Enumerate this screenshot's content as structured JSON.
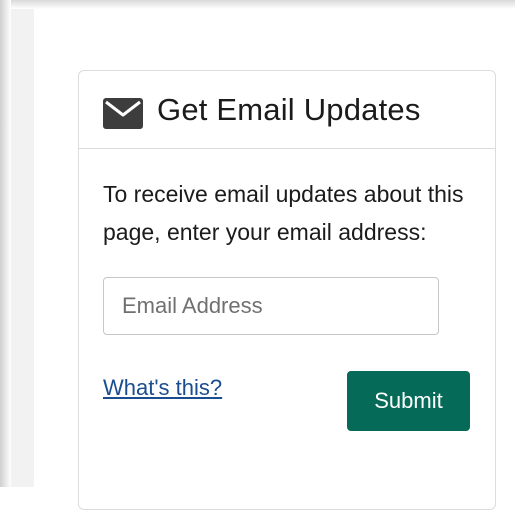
{
  "card": {
    "title": "Get Email Updates",
    "icon": "envelope-icon",
    "intro": "To receive email updates about this page, enter your email address:",
    "email_input": {
      "placeholder": "Email Address",
      "value": ""
    },
    "whats_this_link": "What's this?",
    "submit_label": "Submit"
  },
  "colors": {
    "submit_background": "#056a57",
    "link": "#1a4d8f",
    "icon": "#3d3d3d"
  }
}
